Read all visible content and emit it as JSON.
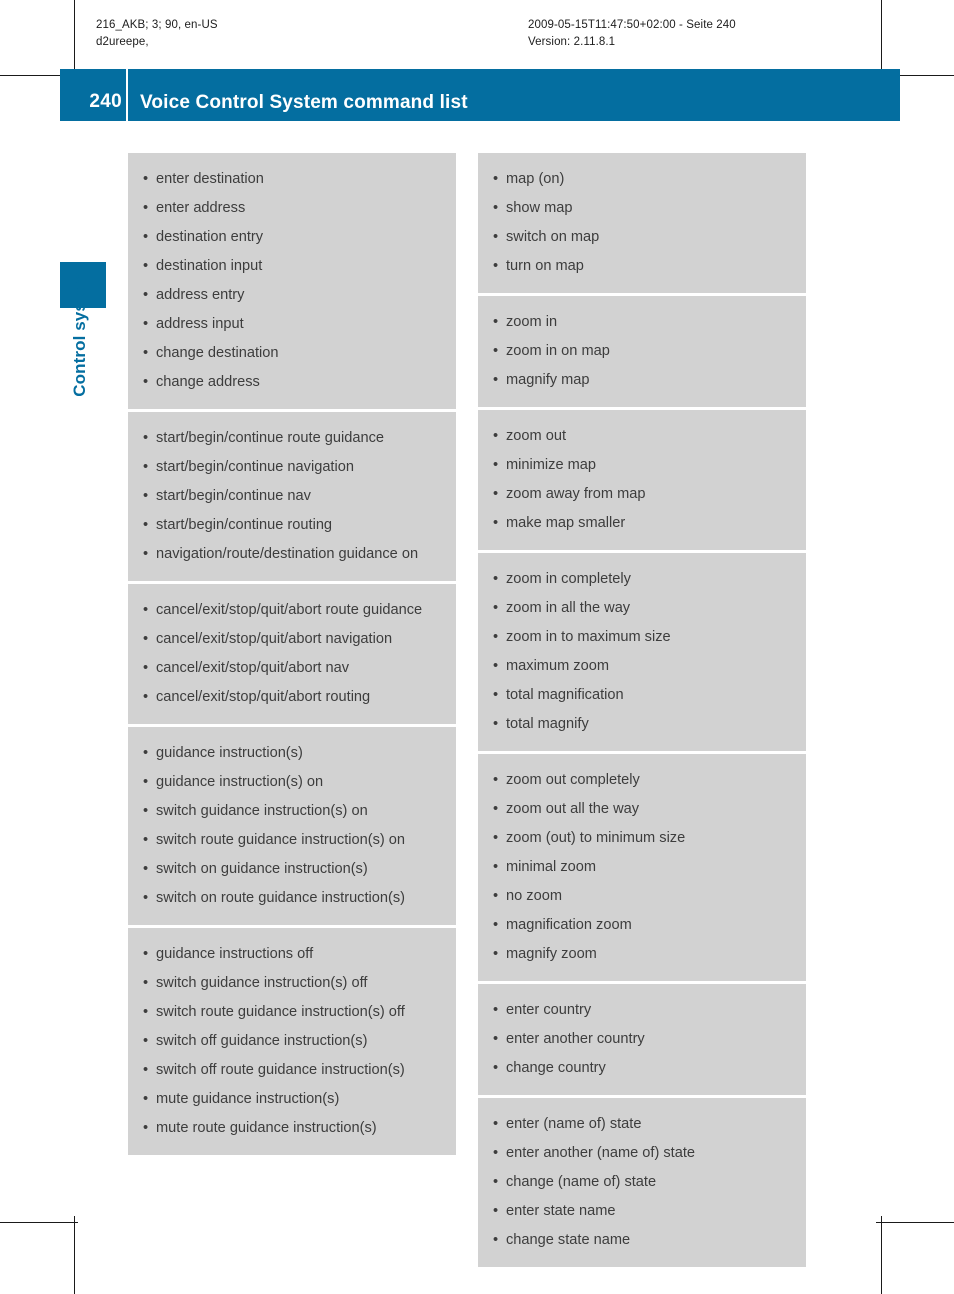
{
  "print_marks": {
    "job_info": "216_AKB; 3; 90, en-US\nd2ureepe,",
    "timestamp_info": "2009-05-15T11:47:50+02:00 - Seite 240\nVersion: 2.11.8.1"
  },
  "header": {
    "page_number": "240",
    "title": "Voice Control System command list",
    "accent_color": "#046ea0"
  },
  "side_tab": {
    "label": "Control systems",
    "color": "#046ea0"
  },
  "colors": {
    "panel_bg": "#d2d2d2",
    "text": "#3d3d3d",
    "divider": "#ffffff"
  },
  "columns": [
    {
      "name": "left-column",
      "blocks": [
        {
          "name": "destination-entry-commands",
          "items": [
            "enter destination",
            "enter address",
            "destination entry",
            "destination input",
            "address entry",
            "address input",
            "change destination",
            "change address"
          ]
        },
        {
          "name": "start-route-guidance-commands",
          "items": [
            "start/begin/continue route guidance",
            "start/begin/continue navigation",
            "start/begin/continue nav",
            "start/begin/continue routing",
            "navigation/route/destination guidance on"
          ]
        },
        {
          "name": "cancel-route-guidance-commands",
          "items": [
            "cancel/exit/stop/quit/abort route guidance",
            "cancel/exit/stop/quit/abort navigation",
            "cancel/exit/stop/quit/abort nav",
            "cancel/exit/stop/quit/abort routing"
          ]
        },
        {
          "name": "guidance-instructions-on-commands",
          "items": [
            "guidance instruction(s)",
            "guidance instruction(s) on",
            "switch guidance instruction(s) on",
            "switch route guidance instruction(s) on",
            "switch on guidance instruction(s)",
            "switch on route guidance instruction(s)"
          ]
        },
        {
          "name": "guidance-instructions-off-commands",
          "items": [
            "guidance instructions off",
            "switch guidance instruction(s) off",
            "switch route guidance instruction(s) off",
            "switch off guidance instruction(s)",
            "switch off route guidance instruction(s)",
            "mute guidance instruction(s)",
            "mute route guidance instruction(s)"
          ]
        }
      ]
    },
    {
      "name": "right-column",
      "blocks": [
        {
          "name": "show-map-commands",
          "items": [
            "map (on)",
            "show map",
            "switch on map",
            "turn on map"
          ]
        },
        {
          "name": "zoom-in-commands",
          "items": [
            "zoom in",
            "zoom in on map",
            "magnify map"
          ]
        },
        {
          "name": "zoom-out-commands",
          "items": [
            "zoom out",
            "minimize map",
            "zoom away from map",
            "make map smaller"
          ]
        },
        {
          "name": "zoom-in-maximum-commands",
          "items": [
            "zoom in completely",
            "zoom in all the way",
            "zoom in to maximum size",
            "maximum zoom",
            "total magnification",
            "total magnify"
          ]
        },
        {
          "name": "zoom-out-minimum-commands",
          "items": [
            "zoom out completely",
            "zoom out all the way",
            "zoom (out) to minimum size",
            "minimal zoom",
            "no zoom",
            "magnification zoom",
            "magnify zoom"
          ]
        },
        {
          "name": "country-commands",
          "items": [
            "enter country",
            "enter another country",
            "change country"
          ]
        },
        {
          "name": "state-commands",
          "items": [
            "enter (name of) state",
            "enter another (name of) state",
            "change (name of) state",
            "enter state name",
            "change state name"
          ]
        }
      ]
    }
  ]
}
